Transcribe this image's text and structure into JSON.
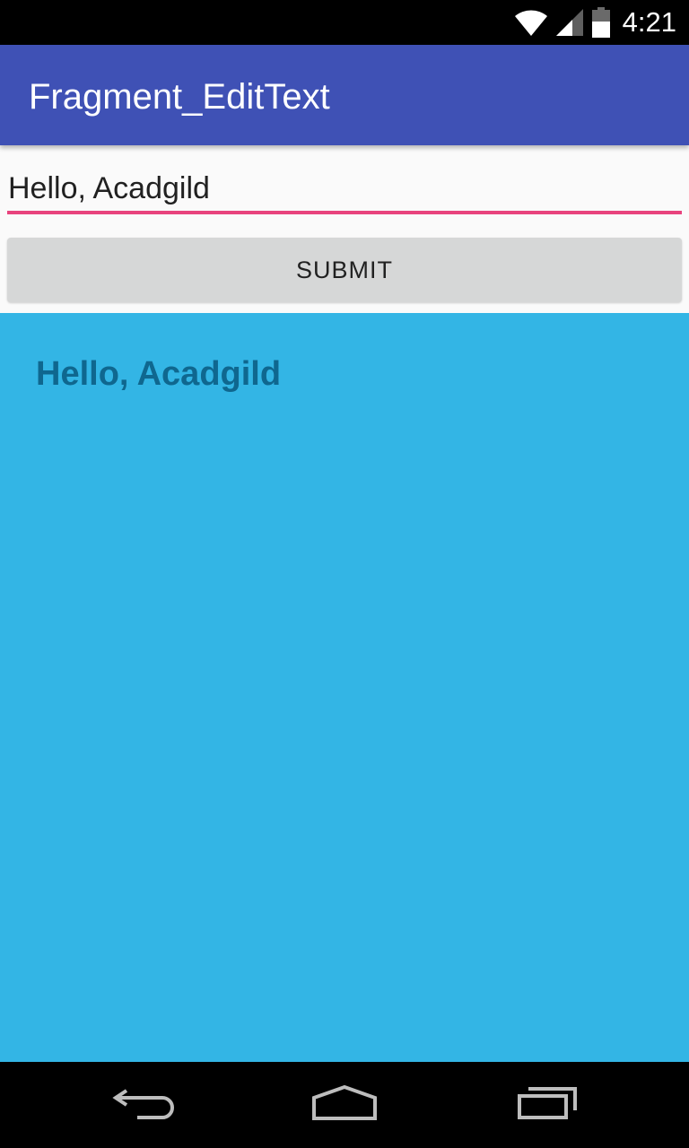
{
  "status_bar": {
    "time": "4:21",
    "icons": [
      "wifi-icon",
      "cell-signal-icon",
      "battery-icon"
    ]
  },
  "app_bar": {
    "title": "Fragment_EditText",
    "color": "#3f51b5"
  },
  "edit_text": {
    "value": "Hello, Acadgild",
    "underline_color": "#e8437d"
  },
  "submit_button": {
    "label": "SUBMIT"
  },
  "fragment": {
    "text": "Hello, Acadgild",
    "background_color": "#33b5e5",
    "text_color": "#0f678f"
  },
  "nav_bar": {
    "buttons": [
      "back-icon",
      "home-icon",
      "recents-icon"
    ]
  }
}
